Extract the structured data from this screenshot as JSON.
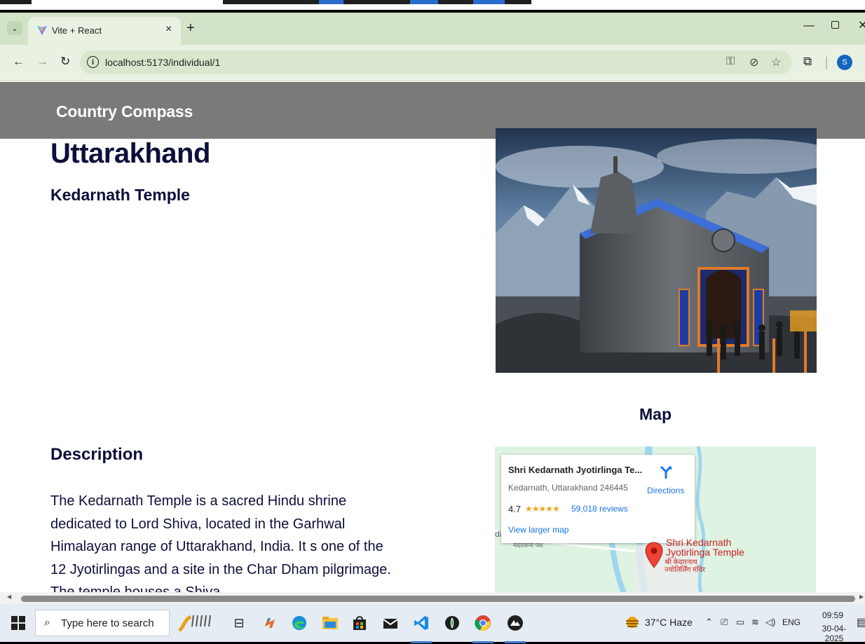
{
  "browser": {
    "tab_title": "Vite + React",
    "tab_close": "×",
    "new_tab": "+",
    "url": "localhost:5173/individual/1",
    "profile_initial": "S"
  },
  "page": {
    "brand": "Country Compass",
    "state_title": "Uttarakhand",
    "place_subtitle": "Kedarnath Temple",
    "map_heading": "Map",
    "description_heading": "Description",
    "description_text": "The Kedarnath Temple is a sacred Hindu shrine dedicated to Lord Shiva, located in the Garhwal Himalayan range of Uttarakhand, India. It s one of the 12 Jyotirlingas and a site in the Char Dham pilgrimage. The temple houses a Shiva"
  },
  "map": {
    "place_name": "Shri Kedarnath Jyotirlinga Te...",
    "address": "Kedarnath, Uttarakhand 246445",
    "rating": "4.7",
    "stars": "★★★★★",
    "reviews": "59,018 reviews",
    "directions": "Directions",
    "view_larger": "View larger map",
    "pin_label_line1": "Shri Kedarnath",
    "pin_label_line2": "Jyotirlinga Temple",
    "pin_hindi_line1": "श्री केदारनाथ",
    "pin_hindi_line2": "ज्योतिर्लिंग मंदिर",
    "road_label": "मंदाकिनी पथ",
    "edge_text": "di"
  },
  "taskbar": {
    "search_placeholder": "Type here to search",
    "weather": "37°C  Haze",
    "language": "ENG",
    "time": "09:59",
    "date": "30-04-2025"
  },
  "colors": {
    "navbar": "#7a7a7a",
    "heading": "#0d0f3a",
    "browser_frame": "#d3e3c8",
    "map_bg": "#dff3e3",
    "link": "#1a73e8",
    "pin": "#c5221f"
  }
}
